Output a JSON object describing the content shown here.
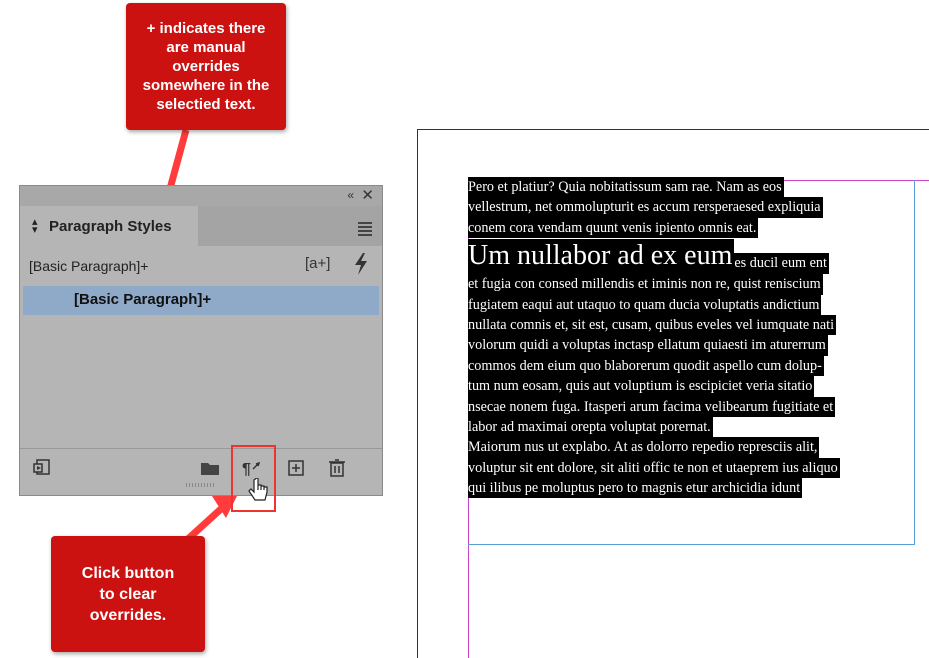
{
  "callouts": {
    "top": "+ indicates there\nare manual\noverrides\nsomewhere in the\nselectied text.",
    "bottom": "Click button\nto clear\noverrides."
  },
  "panel": {
    "title": "Paragraph Styles",
    "collapse_icon": "«",
    "close_icon": "✕",
    "current_style": "[Basic Paragraph]+",
    "new_style_icon": "[a+]",
    "list_items": [
      "[Basic Paragraph]+"
    ],
    "footer_icons": [
      "load-styles-icon",
      "folder-icon",
      "clear-overrides-icon",
      "new-style-icon",
      "delete-icon"
    ]
  },
  "document": {
    "lines": [
      "Pero et platiur? Quia nobitatissum sam rae. Nam as eos",
      "vellestrum, net ommolupturit es accum rersperaesed expliquia",
      "conem cora vendam quunt venis ipiento omnis eat.",
      "Um nullabor ad ex eum",
      "es ducil eum ent",
      "et fugia con consed millendis et iminis non re, quist reniscium",
      "fugiatem eaqui aut utaquo to quam ducia voluptatis andictium",
      "nullata comnis et, sit est, cusam, quibus eveles vel iumquate nati",
      "volorum quidi a voluptas inctasp ellatum quiaesti im aturerrum",
      "commos dem eium quo blaborerum quodit aspello cum dolup-",
      "tum num eosam, quis aut voluptium is escipiciet veria sitatio",
      "nsecae nonem fuga. Itasperi arum facima velibearum fugitiate et",
      "labor ad maximai orepta voluptat porernat.",
      "Maiorum nus ut explabo. At as dolorro repedio represciis alit,",
      "voluptur sit ent dolore, sit aliti offic te non et utaeprem ius aliquo",
      "qui ilibus pe moluptus pero to magnis etur archicidia idunt"
    ]
  },
  "colors": {
    "callout": "#cc1111",
    "panel_bg": "#b5b5b5",
    "selection": "#8fa9c9",
    "highlight": "#000000"
  }
}
